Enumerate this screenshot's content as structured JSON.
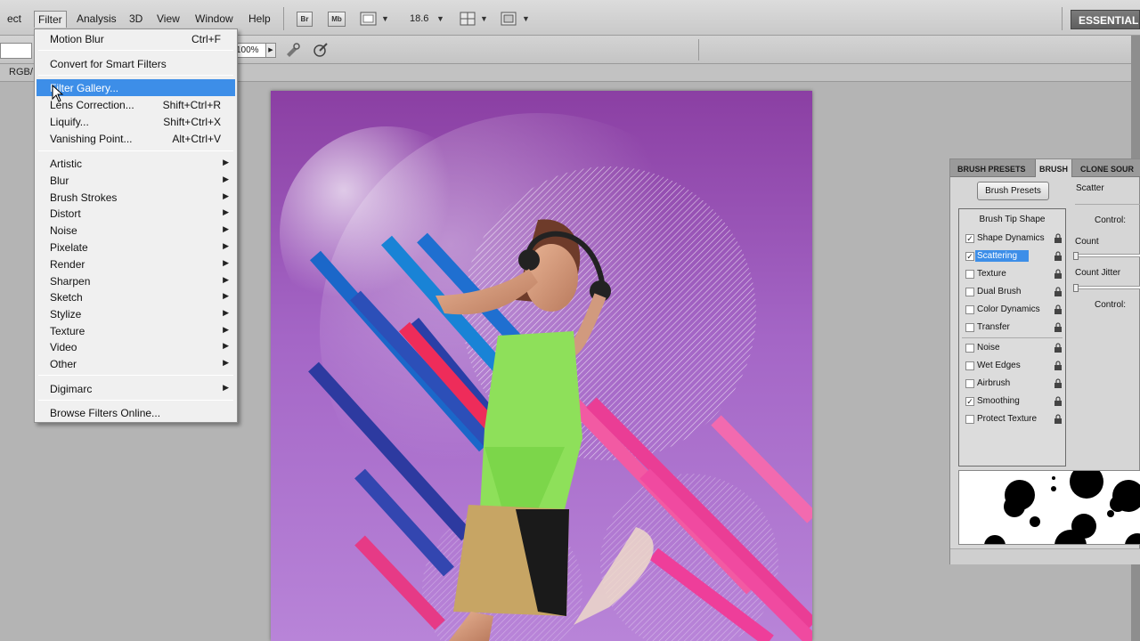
{
  "menubar": {
    "items": [
      "ect",
      "Filter",
      "Analysis",
      "3D",
      "View",
      "Window",
      "Help"
    ],
    "bridge_btn": "Br",
    "minibridge_btn": "Mb",
    "zoom": "18.6",
    "workspace": "ESSENTIAL"
  },
  "options": {
    "opacity_value": "100%"
  },
  "document": {
    "tab_label": "RGB/"
  },
  "filter_menu": {
    "motion_blur": {
      "label": "Motion Blur",
      "shortcut": "Ctrl+F"
    },
    "convert_smart": {
      "label": "Convert for Smart Filters"
    },
    "filter_gallery": {
      "label": "Filter Gallery..."
    },
    "lens_correction": {
      "label": "Lens Correction...",
      "shortcut": "Shift+Ctrl+R"
    },
    "liquify": {
      "label": "Liquify...",
      "shortcut": "Shift+Ctrl+X"
    },
    "vanishing_point": {
      "label": "Vanishing Point...",
      "shortcut": "Alt+Ctrl+V"
    },
    "groups": [
      "Artistic",
      "Blur",
      "Brush Strokes",
      "Distort",
      "Noise",
      "Pixelate",
      "Render",
      "Sharpen",
      "Sketch",
      "Stylize",
      "Texture",
      "Video",
      "Other"
    ],
    "digimarc": "Digimarc",
    "browse_online": "Browse Filters Online..."
  },
  "brush_panel": {
    "tabs": [
      "BRUSH PRESETS",
      "BRUSH",
      "CLONE SOUR"
    ],
    "presets_button": "Brush Presets",
    "list_header": "Brush Tip Shape",
    "items": [
      {
        "label": "Shape Dynamics",
        "checked": "✓"
      },
      {
        "label": "Scattering",
        "checked": "✓"
      },
      {
        "label": "Texture",
        "checked": ""
      },
      {
        "label": "Dual Brush",
        "checked": ""
      },
      {
        "label": "Color Dynamics",
        "checked": ""
      },
      {
        "label": "Transfer",
        "checked": ""
      },
      {
        "label": "Noise",
        "checked": ""
      },
      {
        "label": "Wet Edges",
        "checked": ""
      },
      {
        "label": "Airbrush",
        "checked": ""
      },
      {
        "label": "Smoothing",
        "checked": "✓"
      },
      {
        "label": "Protect Texture",
        "checked": ""
      }
    ],
    "scatter_label": "Scatter",
    "control1": "Control:",
    "count": "Count",
    "count_jitter": "Count Jitter",
    "control2": "Control:"
  }
}
